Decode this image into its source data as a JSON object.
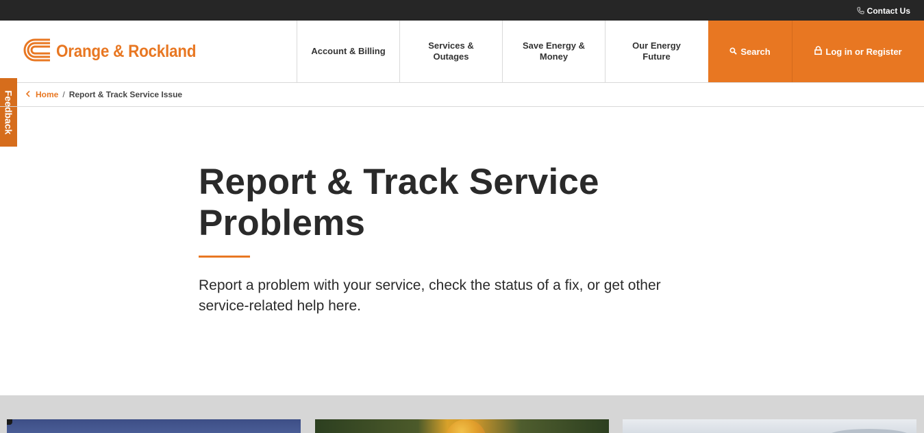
{
  "topbar": {
    "contact_label": "Contact Us"
  },
  "header": {
    "logo_text": "Orange & Rockland",
    "nav_items": [
      {
        "label": "Account & Billing"
      },
      {
        "label": "Services & Outages"
      },
      {
        "label": "Save Energy & Money"
      },
      {
        "label": "Our Energy Future"
      }
    ],
    "search_label": "Search",
    "login_label": "Log in or Register"
  },
  "feedback": {
    "label": "Feedback"
  },
  "breadcrumb": {
    "home": "Home",
    "separator": "/",
    "current": "Report & Track Service Issue"
  },
  "hero": {
    "title": "Report & Track Service Problems",
    "description": "Report a problem with your service, check the status of a fix, or get other service-related help here."
  },
  "colors": {
    "brand_orange": "#e87722",
    "topbar": "#262626",
    "text_dark": "#2a2a2a",
    "band_gray": "#d6d6d6"
  },
  "icons": {
    "contact": "phone-icon",
    "search": "search-icon",
    "login": "lock-icon",
    "breadcrumb": "chevron-left-icon",
    "logo": "logo-mark-icon"
  }
}
